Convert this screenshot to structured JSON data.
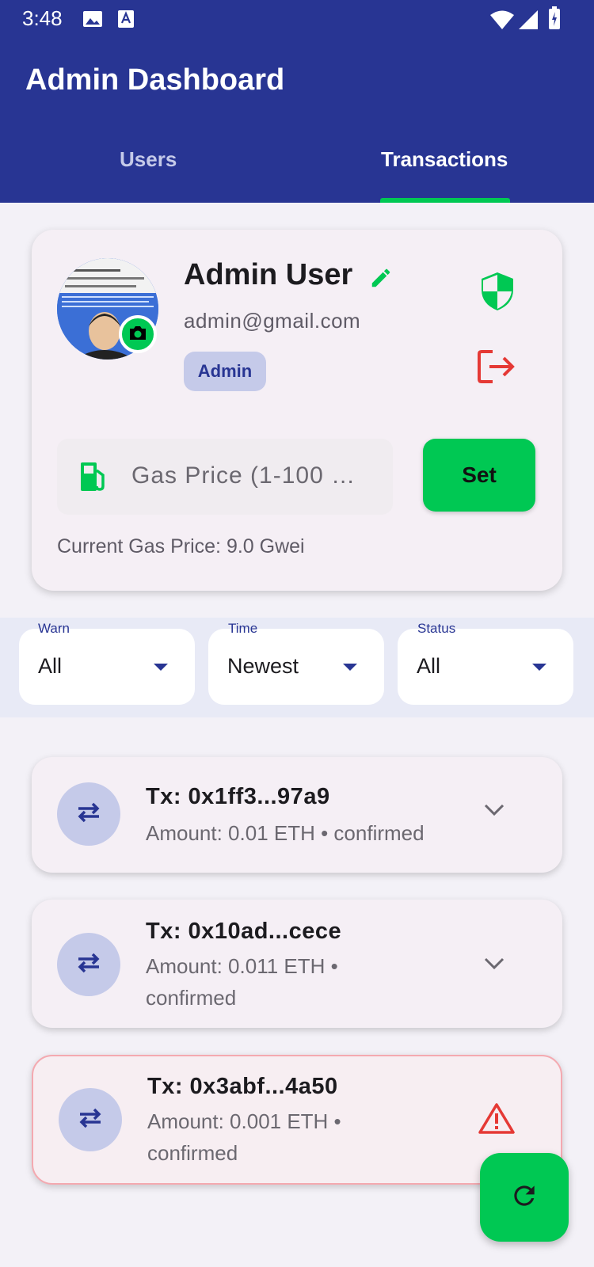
{
  "status_bar": {
    "time": "3:48"
  },
  "app_bar": {
    "title": "Admin Dashboard"
  },
  "tabs": [
    {
      "label": "Users",
      "selected": false
    },
    {
      "label": "Transactions",
      "selected": true
    }
  ],
  "profile": {
    "name": "Admin User",
    "email": "admin@gmail.com",
    "role": "Admin"
  },
  "gas": {
    "placeholder": "Gas Price (1-100 …",
    "set_label": "Set",
    "current": "Current Gas Price: 9.0 Gwei"
  },
  "filters": [
    {
      "label": "Warn",
      "value": "All"
    },
    {
      "label": "Time",
      "value": "Newest"
    },
    {
      "label": "Status",
      "value": "All"
    }
  ],
  "transactions": [
    {
      "title": "Tx: 0x1ff3...97a9",
      "subtitle": "Amount: 0.01 ETH • confirmed",
      "flagged": false
    },
    {
      "title": "Tx: 0x10ad...cece",
      "subtitle": "Amount: 0.011 ETH • confirmed",
      "flagged": false
    },
    {
      "title": "Tx: 0x3abf...4a50",
      "subtitle": "Amount: 0.001 ETH • confirmed",
      "flagged": true
    }
  ],
  "colors": {
    "primary": "#283593",
    "accent": "#00c853",
    "danger": "#e53935",
    "surface": "#f5eff5"
  },
  "icons": {
    "edit": "edit-icon",
    "shield": "shield-icon",
    "logout": "logout-icon",
    "gas": "gas-station-icon",
    "swap": "swap-arrows-icon",
    "expand": "chevron-down-icon",
    "warning": "warning-icon",
    "refresh": "refresh-icon",
    "camera": "camera-icon"
  }
}
